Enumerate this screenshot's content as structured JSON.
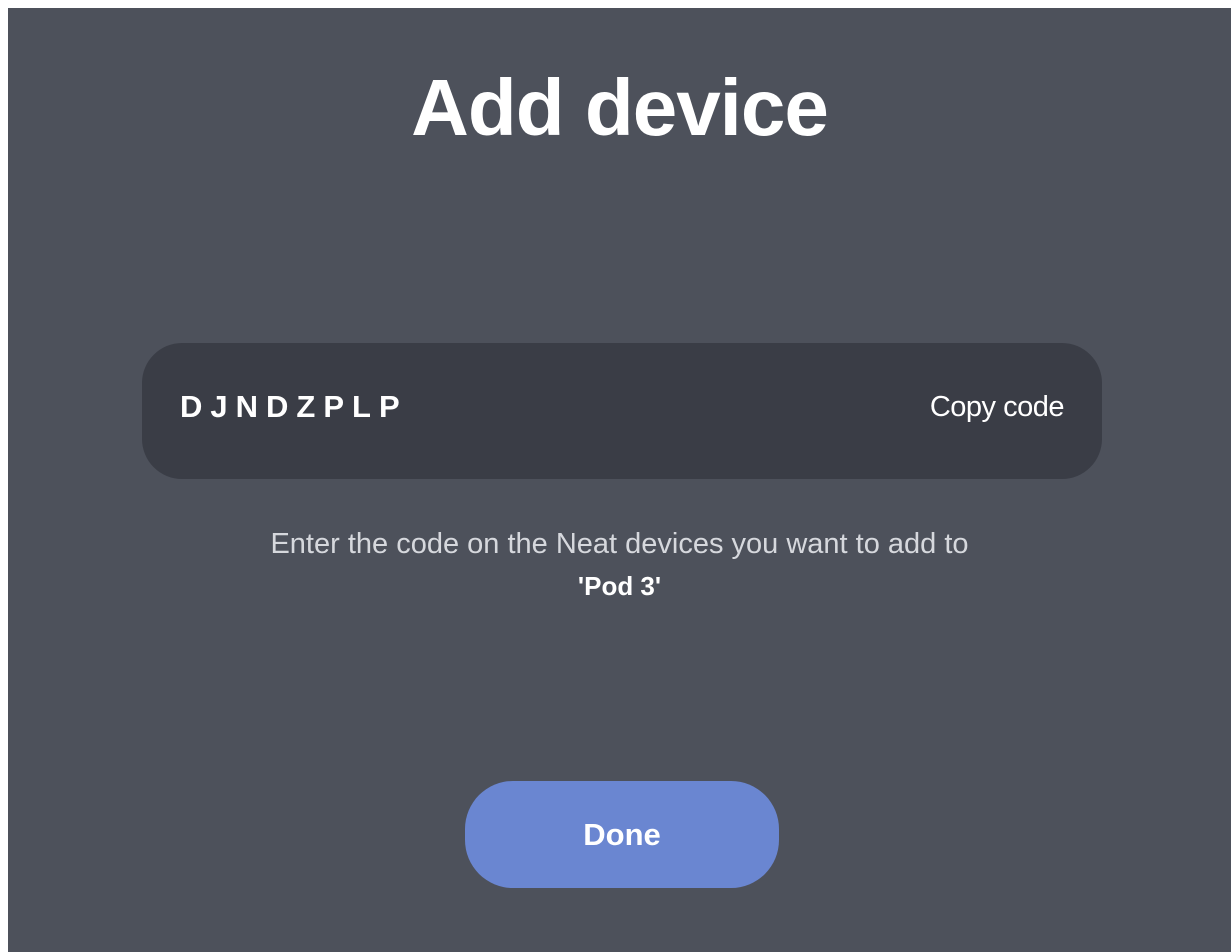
{
  "dialog": {
    "title": "Add device",
    "code": {
      "value": "DJNDZPLP",
      "copy_label": "Copy code"
    },
    "instructions": {
      "text": "Enter the code on the Neat devices you want to add to",
      "target": "'Pod 3'"
    },
    "done_label": "Done"
  },
  "colors": {
    "background": "#4d515b",
    "code_box": "#3a3d46",
    "primary_button": "#6a86d1",
    "text": "#ffffff"
  }
}
